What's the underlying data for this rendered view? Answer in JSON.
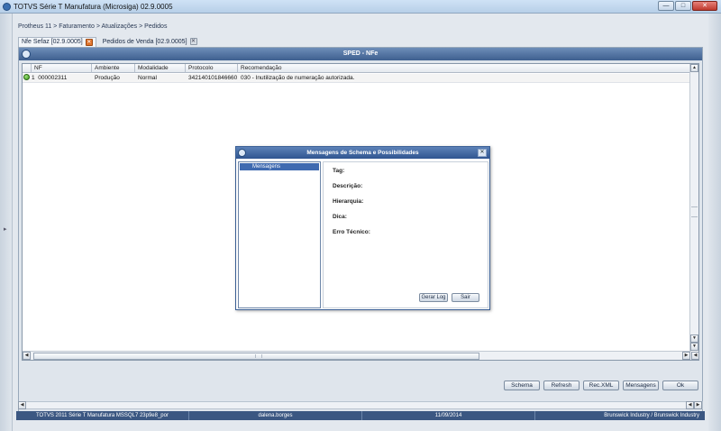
{
  "window": {
    "title": "TOTVS Série T Manufatura (Microsiga) 02.9.0005",
    "controls": {
      "minimize": "—",
      "maximize": "□",
      "close": "✕"
    }
  },
  "breadcrumb": "Protheus 11 > Faturamento > Atualizações > Pedidos",
  "tabs": [
    {
      "label": "Nfe Sefaz [02.9.0005]",
      "close": "✕"
    },
    {
      "label": "Pedidos de Venda [02.9.0005]",
      "close": "✕"
    }
  ],
  "sped": {
    "title": "SPED - NFe"
  },
  "grid": {
    "columns": [
      "NF",
      "Ambiente",
      "Modalidade",
      "Protocolo",
      "Recomendação"
    ],
    "rows": [
      {
        "serie": "1",
        "nf": "000002311",
        "ambiente": "Produção",
        "modalidade": "Normal",
        "protocolo": "342140101846660",
        "recomendacao": "030 - Inutilização de numeração autorizada.",
        "status_color": "#3a9a1a"
      }
    ]
  },
  "buttons": {
    "schema": "Schema",
    "refresh": "Refresh",
    "rec_xml": "Rec.XML",
    "mensagens": "Mensagens",
    "ok": "Ok"
  },
  "dialog": {
    "title": "Mensagens de Schema e Possibilidades",
    "close": "✕",
    "list_item": "Mensagens",
    "fields": [
      "Tag:",
      "Descrição:",
      "Hierarquia:",
      "Dica:",
      "Erro Técnico:"
    ],
    "gerar_log": "Gerar Log",
    "sair": "Sair"
  },
  "status_bar": [
    "TOTVS 2011 Série T Manufatura MSSQL7 23p9e8_por",
    "dalena.borges",
    "11/09/2014",
    "Brunswick Industry / Brunswick Industry"
  ],
  "colors": {
    "accent": "#3e5f8f",
    "status_bar": "#3b5782",
    "ok_status": "#3a9a1a"
  }
}
